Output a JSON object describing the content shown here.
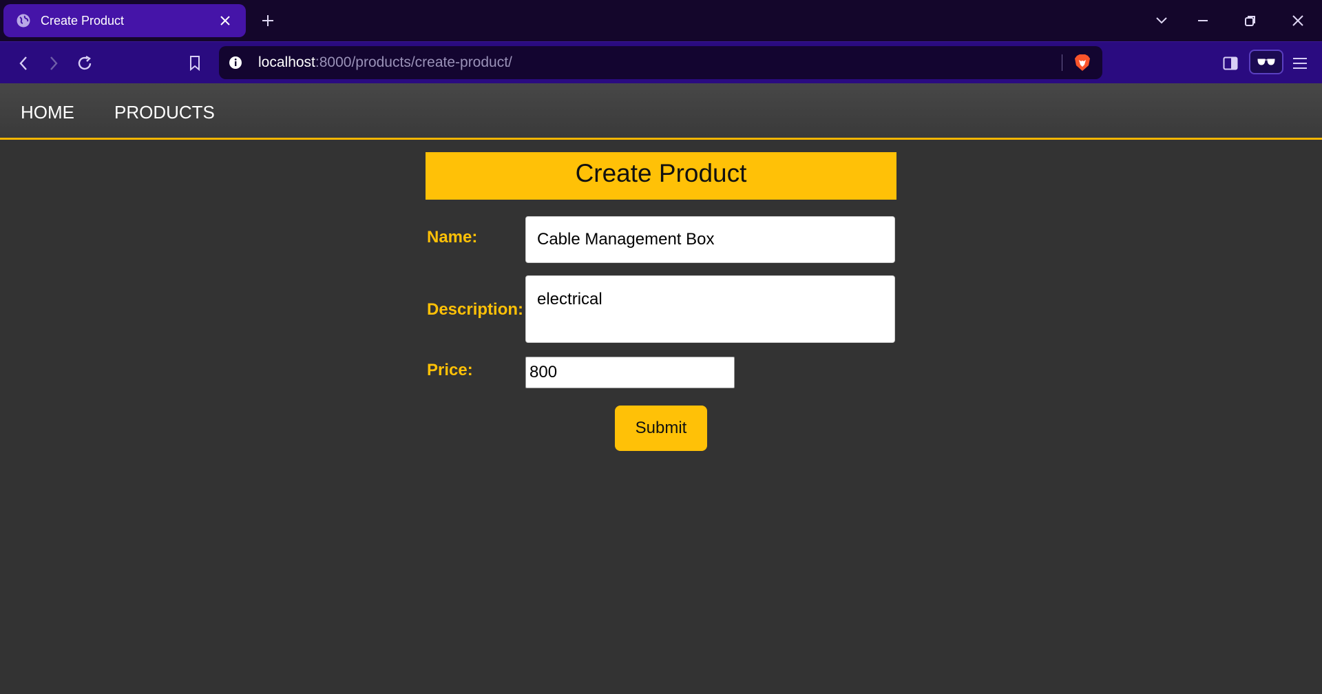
{
  "browser": {
    "tab": {
      "title": "Create Product"
    },
    "url": {
      "host": "localhost",
      "rest": ":8000/products/create-product/"
    }
  },
  "nav": {
    "items": [
      "HOME",
      "PRODUCTS"
    ]
  },
  "form": {
    "title": "Create Product",
    "name": {
      "label": "Name:",
      "value": "Cable Management Box"
    },
    "description": {
      "label": "Description:",
      "value": "electrical"
    },
    "price": {
      "label": "Price:",
      "value": "800"
    },
    "submit_label": "Submit"
  },
  "colors": {
    "accent": "#ffc107",
    "page_bg": "#333333",
    "tab_active": "#4514a8",
    "toolbar": "#2a0b80"
  }
}
